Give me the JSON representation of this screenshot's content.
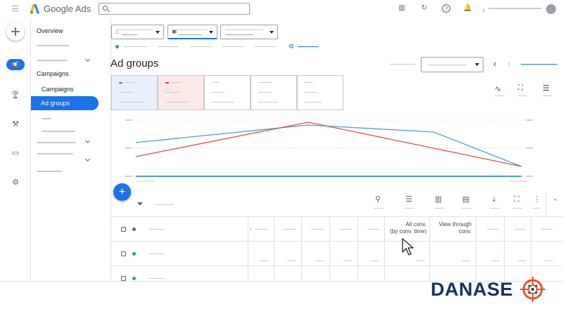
{
  "app": {
    "title": "Google Ads"
  },
  "rail": {
    "items": [
      {
        "name": "campaigns",
        "icon": "megaphone-icon",
        "glyph": "📢",
        "active": true
      },
      {
        "name": "goals",
        "icon": "trophy-icon",
        "glyph": "🏆",
        "active": false
      },
      {
        "name": "tools",
        "icon": "tools-icon",
        "glyph": "⚒",
        "active": false
      },
      {
        "name": "billing",
        "icon": "credit-card-icon",
        "glyph": "▭",
        "active": false
      },
      {
        "name": "admin",
        "icon": "gear-icon",
        "glyph": "⚙",
        "active": false
      }
    ]
  },
  "nav": {
    "overview": "Overview",
    "campaigns_section": "Campaigns",
    "campaigns_item": "Campaigns",
    "active_item": "Ad groups"
  },
  "main": {
    "page_title": "Ad groups",
    "table": {
      "headers": {
        "all_conv": "All conv.",
        "all_conv_sub": "(by conv. time)",
        "view_through": "View through",
        "view_through_sub": "conv."
      }
    }
  },
  "colors": {
    "accent": "#1a73e8",
    "series_blue": "#4a9fd8",
    "series_red": "#d9534f",
    "status_green": "#34a853",
    "brand_navy": "#15345c",
    "brand_orange": "#e8542f"
  },
  "watermark": {
    "prefix": "DANASE",
    "target_icon": "crosshair-target-icon"
  }
}
